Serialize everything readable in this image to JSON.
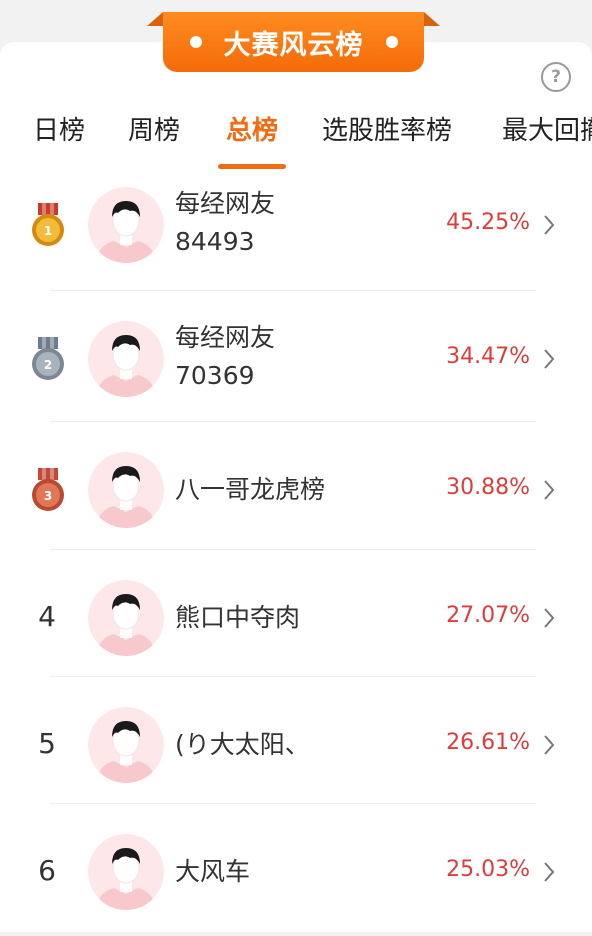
{
  "banner": {
    "title": "大赛风云榜"
  },
  "help": {
    "symbol": "?"
  },
  "tabs": [
    {
      "label": "日榜"
    },
    {
      "label": "周榜"
    },
    {
      "label": "总榜",
      "active": true
    },
    {
      "label": "选股胜率榜"
    },
    {
      "label": "最大回撤"
    }
  ],
  "ranking": [
    {
      "rank": "1",
      "medal": "gold",
      "name_line1": "每经网友",
      "name_line2": "84493",
      "pct": "45.25%"
    },
    {
      "rank": "2",
      "medal": "silver",
      "name_line1": "每经网友",
      "name_line2": "70369",
      "pct": "34.47%"
    },
    {
      "rank": "3",
      "medal": "bronze",
      "name_line1": "八一哥龙虎榜",
      "name_line2": "",
      "pct": "30.88%"
    },
    {
      "rank": "4",
      "medal": "",
      "name_line1": "熊口中夺肉",
      "name_line2": "",
      "pct": "27.07%"
    },
    {
      "rank": "5",
      "medal": "",
      "name_line1": "(り大太阳、",
      "name_line2": "",
      "pct": "26.61%"
    },
    {
      "rank": "6",
      "medal": "",
      "name_line1": "大风车",
      "name_line2": "",
      "pct": "25.03%"
    }
  ],
  "colors": {
    "accent": "#f36c14",
    "gain": "#e03b3b",
    "medal_gold": "#e9a21c",
    "medal_silver": "#8f9aa7",
    "medal_bronze": "#c8553b"
  },
  "icons": {
    "avatar": "default-avatar-icon",
    "chevron": "chevron-right-icon",
    "medal": "medal-icon",
    "help": "help-icon"
  }
}
